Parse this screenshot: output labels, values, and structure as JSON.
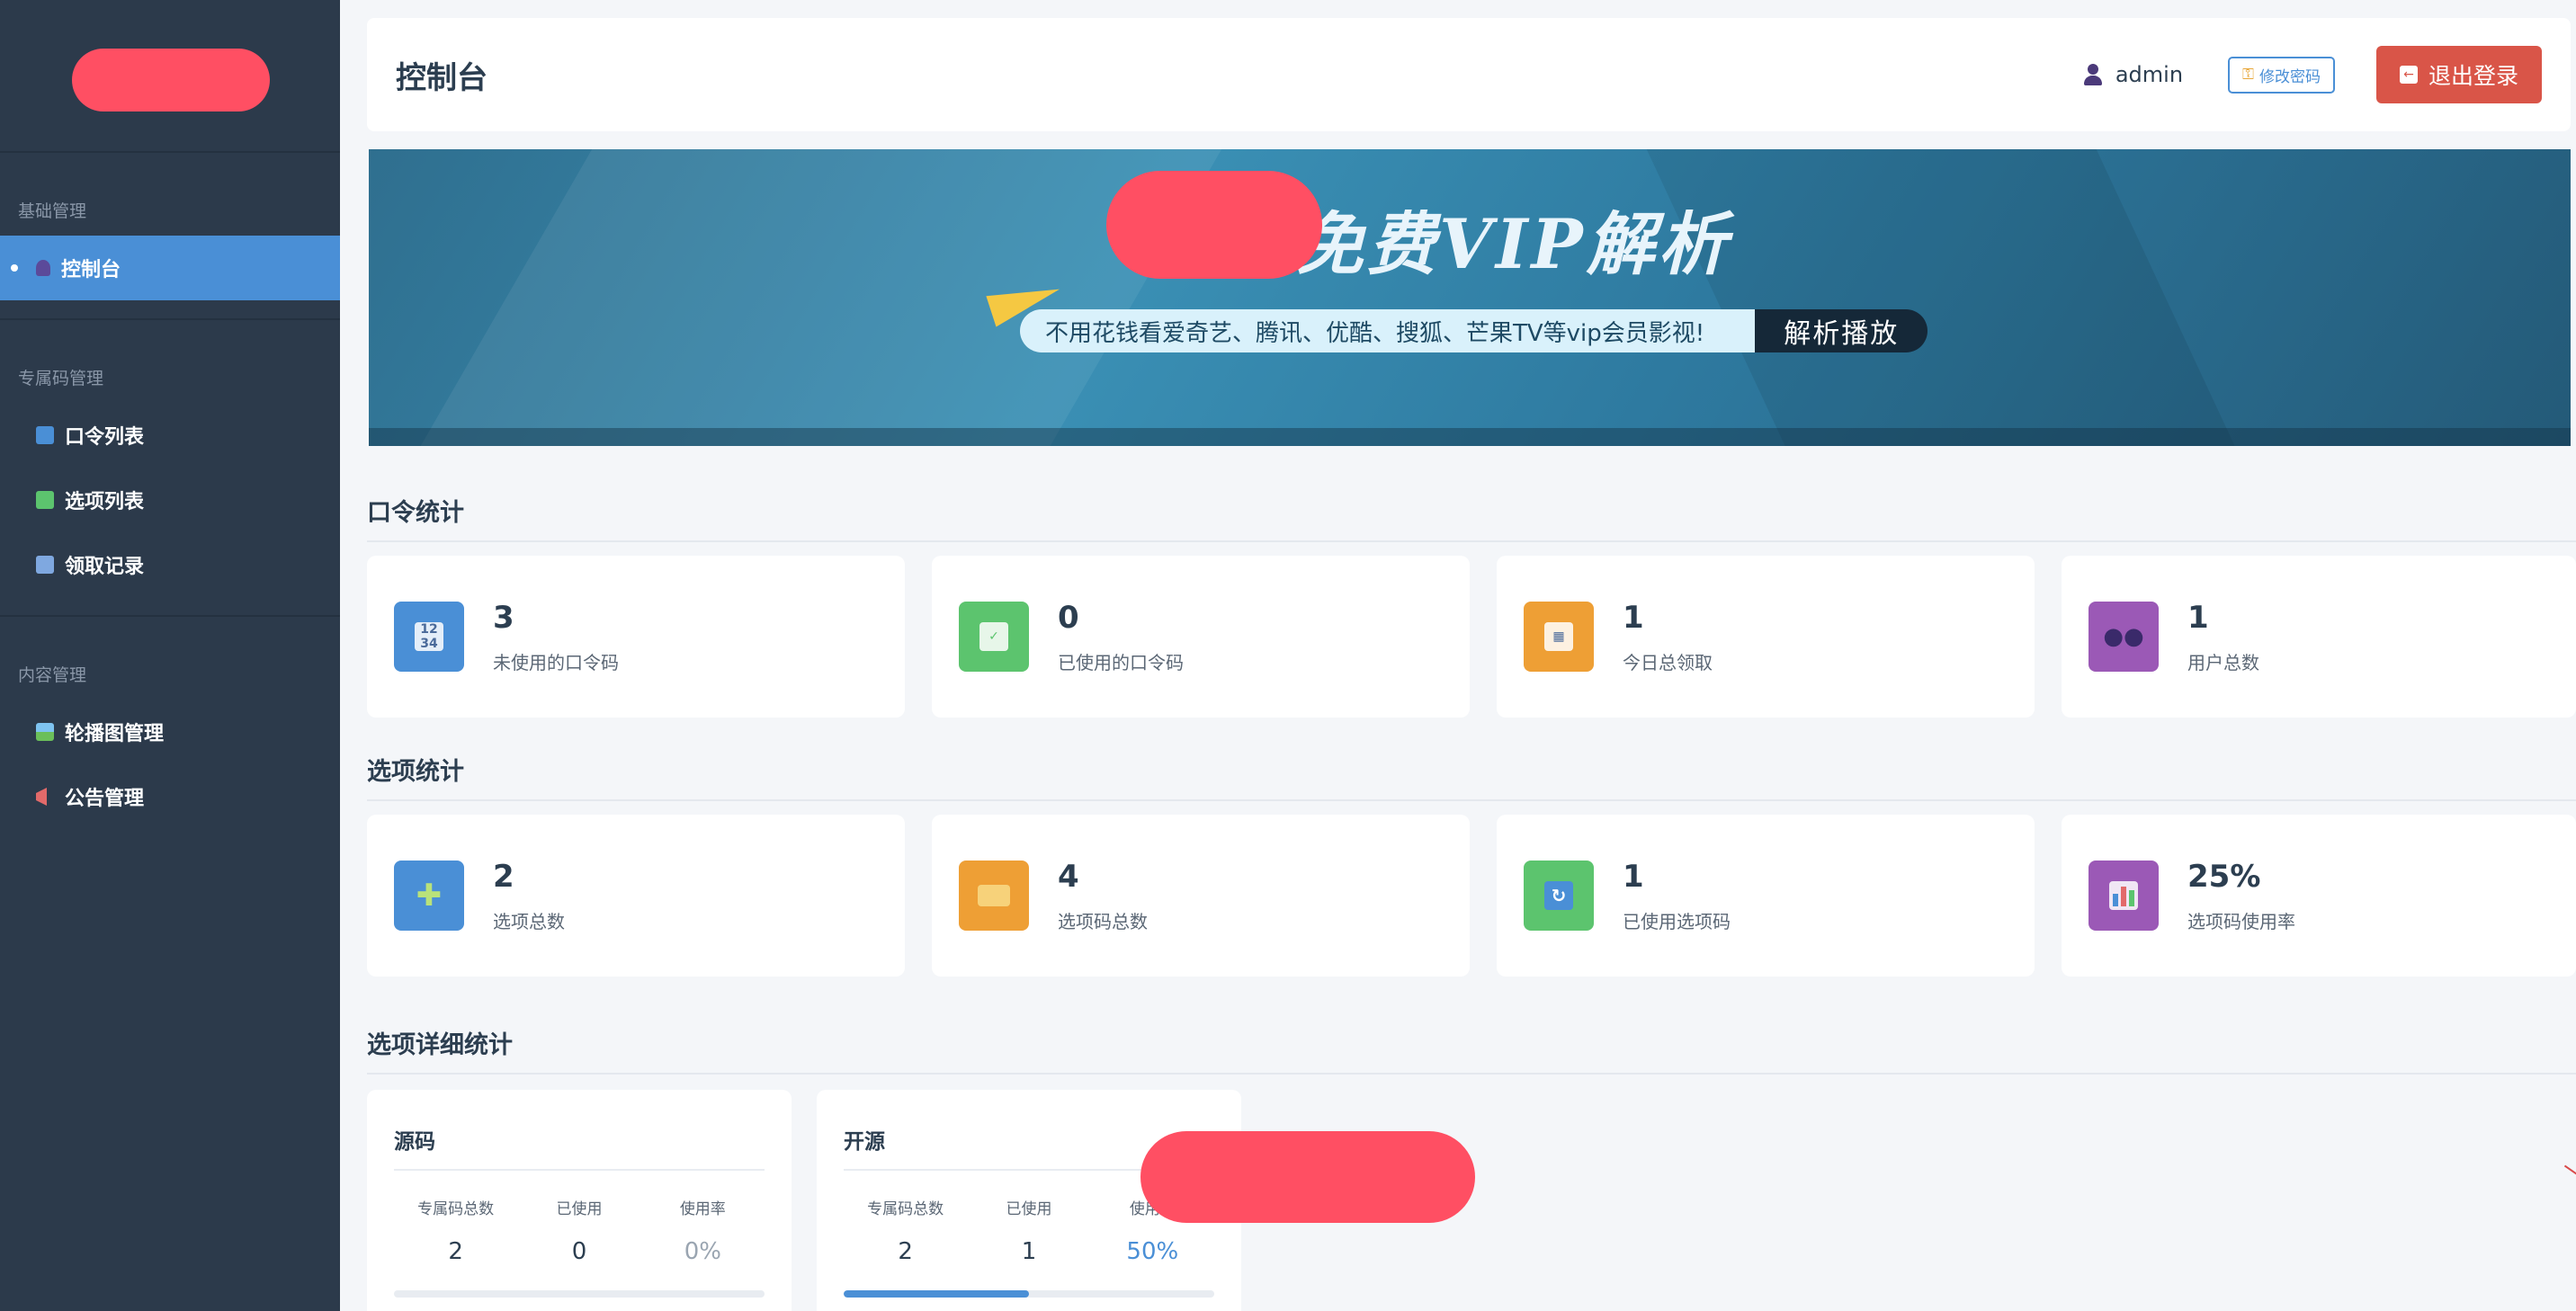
{
  "sidebar": {
    "sections": [
      {
        "title": "基础管理",
        "items": [
          {
            "label": "控制台",
            "icon": "user-icon",
            "active": true
          }
        ]
      },
      {
        "title": "专属码管理",
        "items": [
          {
            "label": "口令列表",
            "icon": "number-grid-icon"
          },
          {
            "label": "选项列表",
            "icon": "checkbox-icon"
          },
          {
            "label": "领取记录",
            "icon": "calendar-icon"
          }
        ]
      },
      {
        "title": "内容管理",
        "items": [
          {
            "label": "轮播图管理",
            "icon": "image-icon"
          },
          {
            "label": "公告管理",
            "icon": "megaphone-icon"
          }
        ]
      }
    ]
  },
  "header": {
    "title": "控制台",
    "username": "admin",
    "change_password": "修改密码",
    "logout": "退出登录"
  },
  "banner": {
    "title": "免费VIP解析",
    "subtitle": "不用花钱看爱奇艺、腾讯、优酷、搜狐、芒果TV等vip会员影视!",
    "button": "解析播放"
  },
  "sections": {
    "code_stats": "口令统计",
    "option_stats": "选项统计",
    "option_detail": "选项详细统计"
  },
  "code_stats": [
    {
      "value": "3",
      "label": "未使用的口令码",
      "icon": "number-grid-icon",
      "color": "#4a8fd6"
    },
    {
      "value": "0",
      "label": "已使用的口令码",
      "icon": "checkbox-icon",
      "color": "#5cc46e"
    },
    {
      "value": "1",
      "label": "今日总领取",
      "icon": "calendar-icon",
      "color": "#ee9f35"
    },
    {
      "value": "1",
      "label": "用户总数",
      "icon": "users-icon",
      "color": "#9b59b6"
    }
  ],
  "option_stats": [
    {
      "value": "2",
      "label": "选项总数",
      "icon": "puzzle-icon",
      "color": "#4a8fd6"
    },
    {
      "value": "4",
      "label": "选项码总数",
      "icon": "id-card-icon",
      "color": "#ee9f35"
    },
    {
      "value": "1",
      "label": "已使用选项码",
      "icon": "refresh-icon",
      "color": "#5cc46e"
    },
    {
      "value": "25%",
      "label": "选项码使用率",
      "icon": "bar-chart-icon",
      "color": "#9b59b6"
    }
  ],
  "option_detail": [
    {
      "name": "源码",
      "total_label": "专属码总数",
      "used_label": "已使用",
      "rate_label": "使用率",
      "total": "2",
      "used": "0",
      "rate": "0%",
      "progress": 0
    },
    {
      "name": "开源",
      "total_label": "专属码总数",
      "used_label": "已使用",
      "rate_label": "使用率",
      "total": "2",
      "used": "1",
      "rate": "50%",
      "progress": 0.5
    }
  ]
}
